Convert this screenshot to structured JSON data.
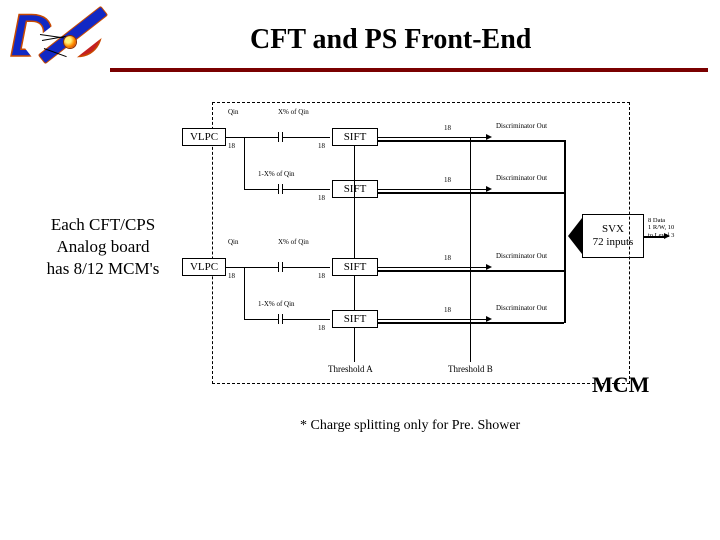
{
  "title": "CFT and PS Front-End",
  "side_text_lines": {
    "l1": "Each CFT/CPS",
    "l2": "Analog board",
    "l3": "has 8/12 MCM's"
  },
  "blocks": {
    "vlpc": "VLPC",
    "sift": "SIFT",
    "svx_line1": "SVX",
    "svx_line2": "72 inputs"
  },
  "labels": {
    "qin": "Qin",
    "xq": "X% of Qin",
    "one_minus_xq": "1-X% of Qin",
    "disc_out": "Discriminator Out",
    "n18": "18",
    "threshold_a": "Threshold A",
    "threshold_b": "Threshold B",
    "svx_note_1": "8 Data",
    "svx_note_2": "1 R/W, 10",
    "svx_note_3": "to Level 3"
  },
  "mcm_label": "MCM",
  "footnote": "* Charge splitting only for Pre. Shower"
}
